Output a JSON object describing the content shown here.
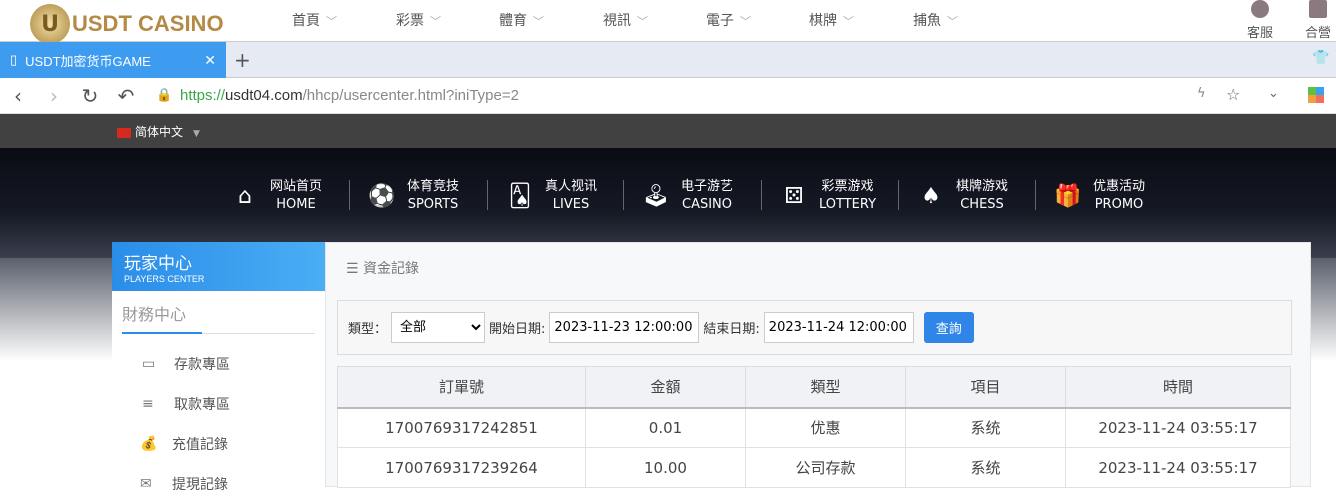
{
  "site": {
    "logo": "USDT CASINO",
    "logo_mark": "U",
    "nav": [
      "首頁",
      "彩票",
      "體育",
      "視訊",
      "電子",
      "棋牌",
      "捕魚"
    ],
    "service": "客服",
    "partner": "合營"
  },
  "browser": {
    "tab_title": "USDT加密货币GAME",
    "url_scheme": "https://",
    "url_domain": "usdt04.com",
    "url_path": "/hhcp/usercenter.html?iniType=2"
  },
  "lang": "简体中文",
  "mainnav": [
    {
      "cn": "网站首页",
      "en": "HOME",
      "icon": "⌂"
    },
    {
      "cn": "体育竞技",
      "en": "SPORTS",
      "icon": "⚽"
    },
    {
      "cn": "真人视讯",
      "en": "LIVES",
      "icon": "🂡"
    },
    {
      "cn": "电子游艺",
      "en": "CASINO",
      "icon": "🕹"
    },
    {
      "cn": "彩票游戏",
      "en": "LOTTERY",
      "icon": "⚄"
    },
    {
      "cn": "棋牌游戏",
      "en": "CHESS",
      "icon": "♠"
    },
    {
      "cn": "优惠活动",
      "en": "PROMO",
      "icon": "🎁"
    }
  ],
  "sidebar": {
    "title": "玩家中心",
    "subtitle": "PLAYERS CENTER",
    "section": "財務中心",
    "items": [
      {
        "label": "存款專區",
        "icon": "▭"
      },
      {
        "label": "取款專區",
        "icon": "≡"
      },
      {
        "label": "充值記錄",
        "icon": "💰"
      },
      {
        "label": "提現記錄",
        "icon": "✉"
      }
    ]
  },
  "main": {
    "crumb": "☰ 資金記錄",
    "type_label": "類型：",
    "type_value": "全部",
    "start_label": "開始日期:",
    "start_value": "2023-11-23 12:00:00",
    "end_label": "結束日期:",
    "end_value": "2023-11-24 12:00:00",
    "query": "查詢",
    "columns": [
      "訂單號",
      "金額",
      "類型",
      "項目",
      "時間"
    ],
    "rows": [
      [
        "1700769317242851",
        "0.01",
        "优惠",
        "系统",
        "2023-11-24 03:55:17"
      ],
      [
        "1700769317239264",
        "10.00",
        "公司存款",
        "系统",
        "2023-11-24 03:55:17"
      ]
    ]
  }
}
